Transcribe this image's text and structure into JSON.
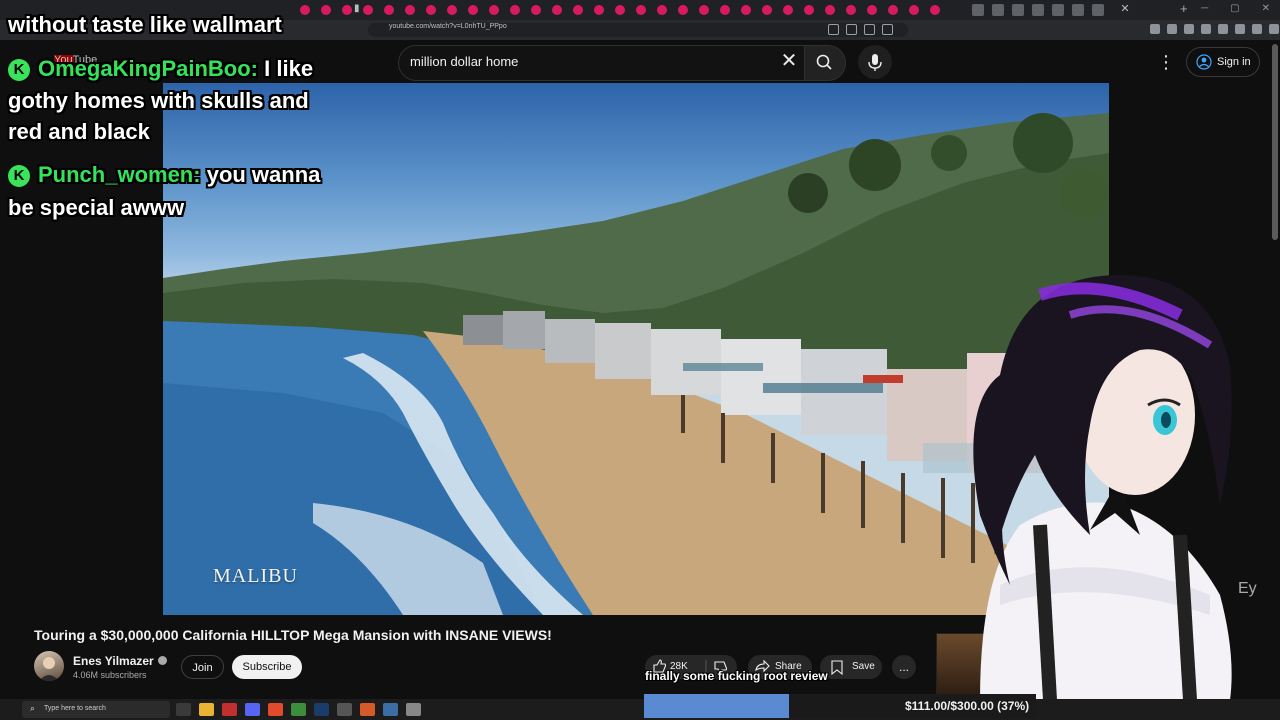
{
  "browser": {
    "url": "youtube.com/watch?v=L0nhTU_PPpo"
  },
  "youtube": {
    "logo_text": "YouTube",
    "search_query": "million dollar home",
    "sign_in_label": "Sign in"
  },
  "video": {
    "overlay_text": "MALIBU",
    "title": "Touring a $30,000,000 California HILLTOP Mega Mansion with INSANE VIEWS!"
  },
  "channel": {
    "name": "Enes Yilmazer",
    "subscribers": "4.06M subscribers",
    "join_label": "Join",
    "subscribe_label": "Subscribe"
  },
  "actions": {
    "like_count": "28K",
    "share_label": "Share",
    "save_label": "Save",
    "more_label": "..."
  },
  "stream_chat": {
    "top_line": "without taste like wallmart",
    "messages": [
      {
        "user": "OmegaKingPainBoo:",
        "text_1": "I like",
        "text_2": "gothy homes with skulls and",
        "text_3": "red and black"
      },
      {
        "user": "Punch_women:",
        "text_1": "you wanna",
        "text_2": "be special awww"
      }
    ],
    "caption": "finally some fucking root review"
  },
  "donation_goal": {
    "label": "$111.00/$300.00 (37%)",
    "fraction": 0.37
  },
  "taskbar": {
    "search_placeholder": "Type here to search"
  },
  "colors": {
    "chat_name": "#35e35a",
    "progress_fill": "#5a8ad1",
    "youtube_bg": "#0f0f0f"
  }
}
